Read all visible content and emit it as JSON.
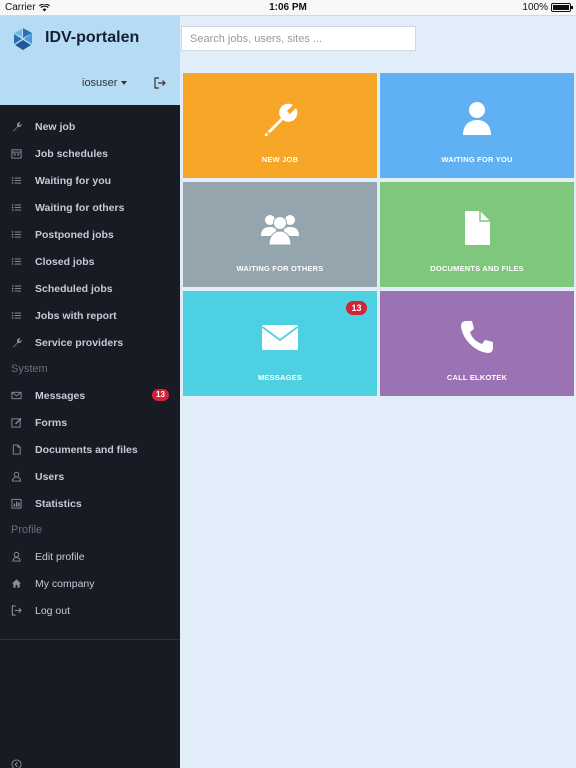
{
  "status_bar": {
    "carrier": "Carrier",
    "time": "1:06 PM",
    "battery": "100%"
  },
  "app": {
    "title": "IDV-portalen",
    "username": "iosuser"
  },
  "search": {
    "placeholder": "Search jobs, users, sites ..."
  },
  "sidebar": {
    "jobs": [
      {
        "label": "New job",
        "icon": "wrench-icon"
      },
      {
        "label": "Job schedules",
        "icon": "calendar-icon"
      },
      {
        "label": "Waiting for you",
        "icon": "list-icon"
      },
      {
        "label": "Waiting for others",
        "icon": "list-icon"
      },
      {
        "label": "Postponed jobs",
        "icon": "list-icon"
      },
      {
        "label": "Closed jobs",
        "icon": "list-icon"
      },
      {
        "label": "Scheduled jobs",
        "icon": "list-icon"
      },
      {
        "label": "Jobs with report",
        "icon": "list-icon"
      },
      {
        "label": "Service providers",
        "icon": "wrench-icon"
      }
    ],
    "system_label": "System",
    "system": [
      {
        "label": "Messages",
        "icon": "envelope-icon",
        "badge": "13"
      },
      {
        "label": "Forms",
        "icon": "edit-icon"
      },
      {
        "label": "Documents and files",
        "icon": "file-icon"
      },
      {
        "label": "Users",
        "icon": "users-icon"
      },
      {
        "label": "Statistics",
        "icon": "chart-icon"
      }
    ],
    "profile_label": "Profile",
    "profile": [
      {
        "label": "Edit profile",
        "icon": "user-icon"
      },
      {
        "label": "My company",
        "icon": "home-icon"
      },
      {
        "label": "Log out",
        "icon": "logout-icon"
      }
    ]
  },
  "tiles": [
    {
      "label": "NEW JOB",
      "icon": "wrench-icon",
      "color": "#f7a627"
    },
    {
      "label": "WAITING FOR YOU",
      "icon": "user-icon",
      "color": "#60b0f4"
    },
    {
      "label": "WAITING FOR OTHERS",
      "icon": "users-icon",
      "color": "#95a5ad"
    },
    {
      "label": "DOCUMENTS AND FILES",
      "icon": "file-icon",
      "color": "#80c77e"
    },
    {
      "label": "MESSAGES",
      "icon": "envelope-icon",
      "color": "#4dd0e1",
      "badge": "13"
    },
    {
      "label": "CALL ELKOTEK",
      "icon": "phone-icon",
      "color": "#9b72b4"
    }
  ]
}
